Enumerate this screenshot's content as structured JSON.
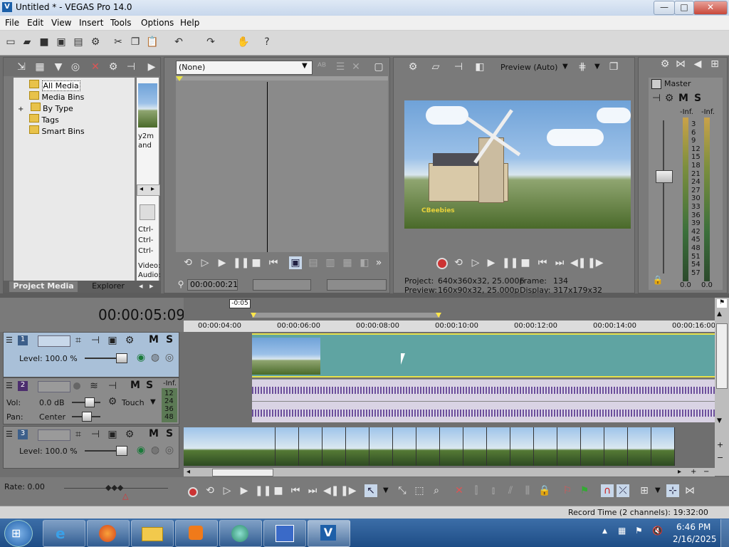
{
  "window": {
    "title": "Untitled * - VEGAS Pro 14.0",
    "app_icon": "V",
    "buttons": {
      "min": "—",
      "max": "□",
      "close": "✕"
    }
  },
  "menu": [
    "File",
    "Edit",
    "View",
    "Insert",
    "Tools",
    "Options",
    "Help"
  ],
  "project_media": {
    "tree": [
      {
        "label": "All Media",
        "selected": true
      },
      {
        "label": "Media Bins"
      },
      {
        "label": "By Type",
        "expander": "+"
      },
      {
        "label": "Tags"
      },
      {
        "label": "Smart Bins"
      }
    ],
    "thumb_caption_1": "y2m",
    "thumb_caption_2": "and",
    "info_lines": [
      "Ctrl-",
      "Ctrl-",
      "Ctrl-"
    ],
    "video_label": "Video:",
    "audio_label": "Audio:",
    "tabs": {
      "project_media": "Project Media",
      "explorer": "Explorer"
    }
  },
  "trimmer": {
    "dropdown_value": "(None)",
    "timecode": "00:00:00:21"
  },
  "preview": {
    "mode": "Preview (Auto)",
    "project_label": "Project:",
    "project_value": "640x360x32, 25.000p",
    "preview_label": "Preview:",
    "preview_value": "160x90x32, 25.000p",
    "frame_label": "Frame:",
    "frame_value": "134",
    "display_label": "Display:",
    "display_value": "317x179x32",
    "watermark": "CBeebies"
  },
  "master": {
    "title": "Master",
    "m": "M",
    "s": "S",
    "inf_left": "-Inf.",
    "inf_right": "-Inf.",
    "scale": [
      "3",
      "6",
      "9",
      "12",
      "15",
      "18",
      "21",
      "24",
      "27",
      "30",
      "33",
      "36",
      "39",
      "42",
      "45",
      "48",
      "51",
      "54",
      "57"
    ],
    "bottom_left": "0.0",
    "bottom_right": "0.0"
  },
  "timeline": {
    "timecode": "00:00:05:09",
    "region_marker": "-0:05",
    "ruler": [
      "00:00:04:00",
      "00:00:06:00",
      "00:00:08:00",
      "00:00:10:00",
      "00:00:12:00",
      "00:00:14:00",
      "00:00:16:00"
    ],
    "rate": "Rate: 0.00",
    "record_time": "Record Time (2 channels): 19:32:00"
  },
  "tracks": [
    {
      "number": "1",
      "type": "video",
      "level": "Level: 100.0 %",
      "m": "M",
      "s": "S"
    },
    {
      "number": "2",
      "type": "audio",
      "vol_label": "Vol:",
      "vol_value": "0.0 dB",
      "pan_label": "Pan:",
      "pan_value": "Center",
      "mode": "Touch",
      "m": "M",
      "s": "S",
      "inf": "-Inf.",
      "meter": [
        "12",
        "24",
        "36",
        "48"
      ]
    },
    {
      "number": "3",
      "type": "video",
      "level": "Level: 100.0 %",
      "m": "M",
      "s": "S"
    }
  ],
  "taskbar": {
    "time": "6:46 PM",
    "date": "2/16/2025"
  },
  "colors": {
    "panel": "#7a7a7a",
    "video_track_header": "#a9c0d8",
    "audio_clip": "#6c4f9b",
    "video_clip_bg": "#5fa4a2",
    "taskbar": "#2b5c96"
  }
}
